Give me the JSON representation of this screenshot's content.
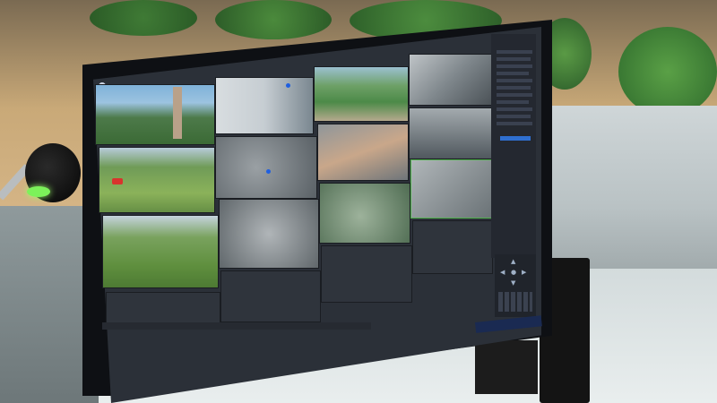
{
  "colors": {
    "screen_bg": "#2b3038",
    "selected_border": "#4fb24b",
    "tree_active": "#2f6fd0"
  },
  "icons": {
    "app_logo": "app-logo-icon",
    "ptz_arrows": [
      "▲",
      "◀",
      "●",
      "▶",
      "▼",
      "◤",
      "◥",
      "◣",
      "◢"
    ]
  },
  "tree_items": [
    "",
    "",
    "",
    "",
    "",
    "",
    "",
    "",
    "",
    "",
    "",
    "",
    "",
    ""
  ],
  "tiles": [
    {
      "id": "cam-1"
    },
    {
      "id": "cam-2"
    },
    {
      "id": "cam-3"
    },
    {
      "id": "cam-4"
    },
    {
      "id": "cam-5"
    },
    {
      "id": "cam-6"
    },
    {
      "id": "cam-7"
    },
    {
      "id": "cam-8"
    },
    {
      "id": "cam-9"
    },
    {
      "id": "cam-10"
    },
    {
      "id": "cam-11"
    },
    {
      "id": "cam-12"
    }
  ]
}
